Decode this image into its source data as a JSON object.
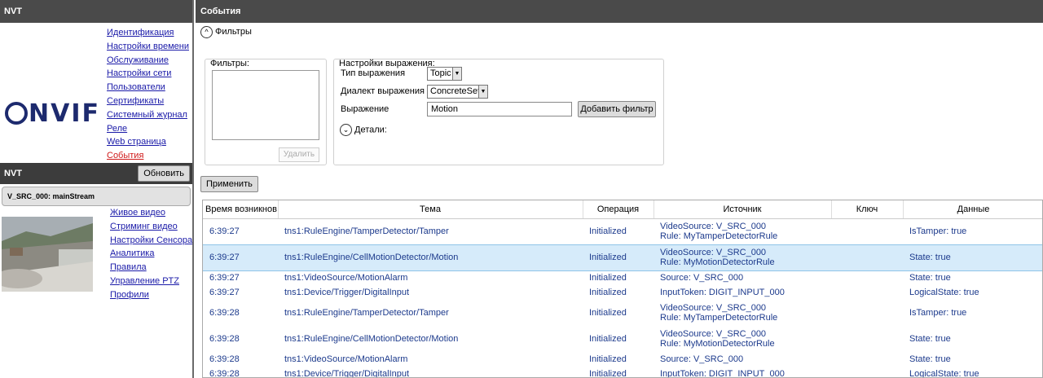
{
  "left": {
    "header": "NVT",
    "menu": [
      {
        "label": "Идентификация",
        "active": false
      },
      {
        "label": "Настройки времени",
        "active": false
      },
      {
        "label": "Обслуживание",
        "active": false
      },
      {
        "label": "Настройки сети",
        "active": false
      },
      {
        "label": "Пользователи",
        "active": false
      },
      {
        "label": "Сертификаты",
        "active": false
      },
      {
        "label": "Системный журнал",
        "active": false
      },
      {
        "label": "Реле",
        "active": false
      },
      {
        "label": "Web страница",
        "active": false
      },
      {
        "label": "События",
        "active": true
      }
    ],
    "device_bar": {
      "title": "NVT",
      "refresh_label": "Обновить"
    },
    "stream_label": "V_SRC_000: mainStream",
    "media_menu": [
      "Живое видео",
      "Стриминг видео",
      "Настройки Сенсора",
      "Аналитика",
      "Правила",
      "Управление PTZ",
      "Профили"
    ]
  },
  "main": {
    "header": "События",
    "filters_toggle": "Фильтры",
    "filters_group": {
      "title": "Фильтры:",
      "delete_label": "Удалить"
    },
    "expression": {
      "title": "Настройки выражения:",
      "type_label": "Тип выражения",
      "type_value": "Topic",
      "dialect_label": "Диалект выражения",
      "dialect_value": "ConcreteSet",
      "expr_label": "Выражение",
      "expr_value": "Motion",
      "add_label": "Добавить фильтр",
      "details_label": "Детали:"
    },
    "apply_label": "Применить",
    "table": {
      "columns": [
        "Время возникнов",
        "Тема",
        "Операция",
        "Источник",
        "Ключ",
        "Данные"
      ],
      "rows": [
        {
          "time": "6:39:27",
          "topic": "tns1:RuleEngine/TamperDetector/Tamper",
          "op": "Initialized",
          "src1": "VideoSource: V_SRC_000",
          "src2": "Rule: MyTamperDetectorRule",
          "key": "",
          "data": "IsTamper: true",
          "selected": false
        },
        {
          "time": "6:39:27",
          "topic": "tns1:RuleEngine/CellMotionDetector/Motion",
          "op": "Initialized",
          "src1": "VideoSource: V_SRC_000",
          "src2": "Rule: MyMotionDetectorRule",
          "key": "",
          "data": "State: true",
          "selected": true
        },
        {
          "time": "6:39:27",
          "topic": "tns1:VideoSource/MotionAlarm",
          "op": "Initialized",
          "src1": "Source: V_SRC_000",
          "src2": "",
          "key": "",
          "data": "State: true",
          "selected": false
        },
        {
          "time": "6:39:27",
          "topic": "tns1:Device/Trigger/DigitalInput",
          "op": "Initialized",
          "src1": "InputToken: DIGIT_INPUT_000",
          "src2": "",
          "key": "",
          "data": "LogicalState: true",
          "selected": false
        },
        {
          "time": "6:39:28",
          "topic": "tns1:RuleEngine/TamperDetector/Tamper",
          "op": "Initialized",
          "src1": "VideoSource: V_SRC_000",
          "src2": "Rule: MyTamperDetectorRule",
          "key": "",
          "data": "IsTamper: true",
          "selected": false
        },
        {
          "time": "6:39:28",
          "topic": "tns1:RuleEngine/CellMotionDetector/Motion",
          "op": "Initialized",
          "src1": "VideoSource: V_SRC_000",
          "src2": "Rule: MyMotionDetectorRule",
          "key": "",
          "data": "State: true",
          "selected": false
        },
        {
          "time": "6:39:28",
          "topic": "tns1:VideoSource/MotionAlarm",
          "op": "Initialized",
          "src1": "Source: V_SRC_000",
          "src2": "",
          "key": "",
          "data": "State: true",
          "selected": false
        },
        {
          "time": "6:39:28",
          "topic": "tns1:Device/Trigger/DigitalInput",
          "op": "Initialized",
          "src1": "InputToken: DIGIT_INPUT_000",
          "src2": "",
          "key": "",
          "data": "LogicalState: true",
          "selected": false
        }
      ]
    }
  }
}
